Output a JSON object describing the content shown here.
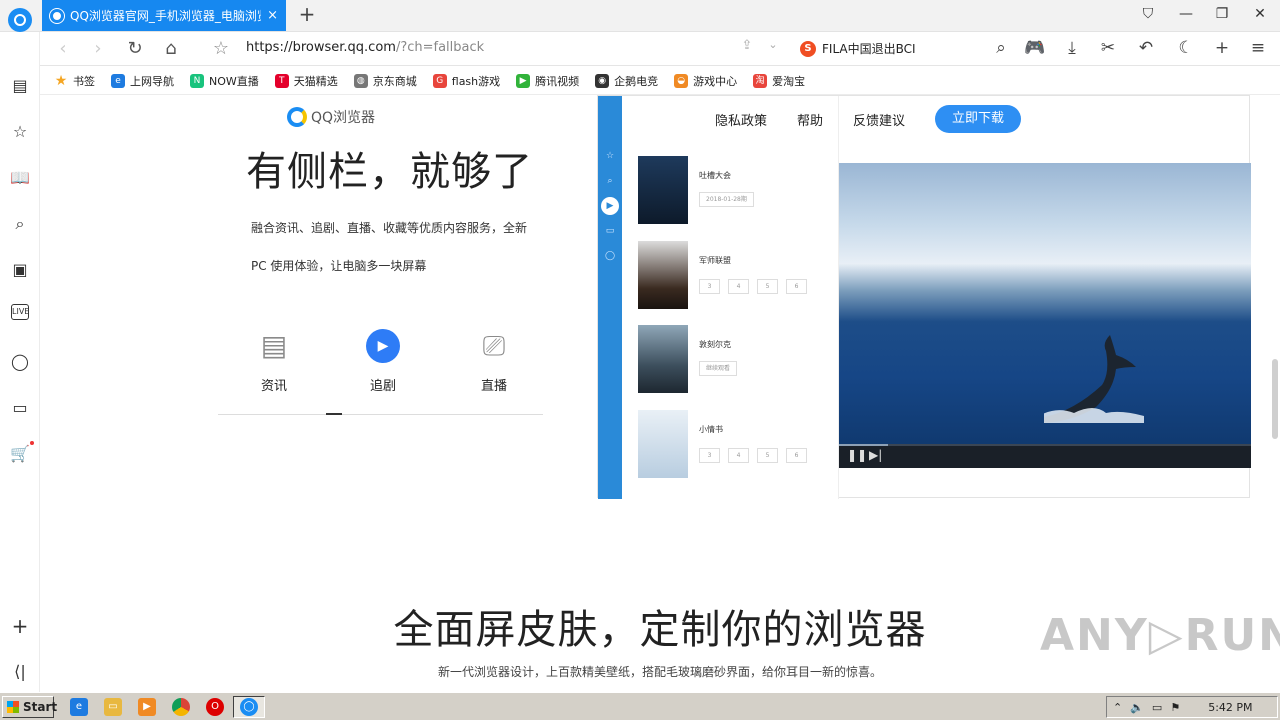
{
  "tabbar": {
    "tab_title": "QQ浏览器官网_手机浏览器_电脑浏览器",
    "close": "×",
    "new_tab": "+",
    "window_controls": {
      "skin": "⛉",
      "minimize": "—",
      "restore": "❐",
      "close": "✕"
    }
  },
  "addressbar": {
    "url_main": "https://browser.qq.com",
    "url_query": "/?ch=fallback",
    "search_engine": "S",
    "search_text": "FILA中国退出BCI"
  },
  "bookmarks": [
    {
      "label": "书签",
      "icon": "★",
      "color": "#f5a623"
    },
    {
      "label": "上网导航",
      "icon": "e",
      "color": "#1e7be0"
    },
    {
      "label": "NOW直播",
      "icon": "N",
      "color": "#19c37d"
    },
    {
      "label": "天猫精选",
      "icon": "T",
      "color": "#e4002b"
    },
    {
      "label": "京东商城",
      "icon": "◍",
      "color": "#777777"
    },
    {
      "label": "flash游戏",
      "icon": "G",
      "color": "#e8453c"
    },
    {
      "label": "腾讯视频",
      "icon": "▶",
      "color": "#31b33a"
    },
    {
      "label": "企鹅电竞",
      "icon": "◉",
      "color": "#333333"
    },
    {
      "label": "游戏中心",
      "icon": "◒",
      "color": "#f08a24"
    },
    {
      "label": "爱淘宝",
      "icon": "淘",
      "color": "#e8453c"
    }
  ],
  "page": {
    "site_logo_text": "QQ浏览器",
    "headline": "有侧栏，就够了",
    "desc_line1": "融合资讯、追剧、直播、收藏等优质内容服务，全新",
    "desc_line2": "PC 使用体验，让电脑多一块屏幕",
    "features": [
      {
        "label": "资讯",
        "icon": "news-icon"
      },
      {
        "label": "追剧",
        "icon": "play-icon"
      },
      {
        "label": "直播",
        "icon": "video-camera-icon"
      }
    ],
    "nav": {
      "privacy": "隐私政策",
      "help": "帮助",
      "feedback": "反馈建议",
      "download": "立即下载"
    },
    "mock_list": [
      {
        "name": "吐槽大会",
        "tag": "2018-01-28期"
      },
      {
        "name": "军师联盟",
        "eps": [
          "3",
          "4",
          "5",
          "6"
        ]
      },
      {
        "name": "敦刻尔克",
        "tag": "继续观看"
      },
      {
        "name": "小情书",
        "eps": [
          "3",
          "4",
          "5",
          "6"
        ]
      }
    ],
    "video_progress": 0.12,
    "hero2_title": "全面屏皮肤，定制你的浏览器",
    "hero2_sub": "新一代浏览器设计，上百款精美壁纸，搭配毛玻璃磨砂界面，给你耳目一新的惊喜。",
    "watermark": "ANY▷RUN"
  },
  "taskbar": {
    "start": "Start",
    "clock": "5:42 PM"
  }
}
